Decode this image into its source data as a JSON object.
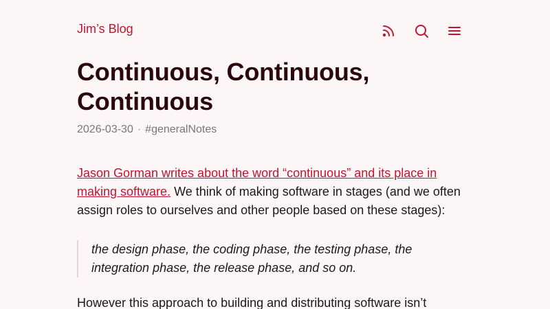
{
  "header": {
    "site_title": "Jim’s Blog",
    "icons": [
      "rss-icon",
      "search-icon",
      "menu-icon"
    ]
  },
  "post": {
    "title": "Continuous, Continuous, Continuous",
    "date": "2026-03-30",
    "meta_separator": "·",
    "tag": "#generalNotes",
    "intro_link": "Jason Gorman writes about the word “continuous” and its place in making software.",
    "intro_text": " We think of making software in stages (and we often assign roles to ourselves and other people based on these stages):",
    "quote": "the design phase, the coding phase, the testing phase, the integration phase, the release phase, and so on.",
    "after_quote": "However this approach to building and distributing software isn’t"
  },
  "colors": {
    "accent": "#c0152f",
    "title": "#2b0810",
    "background": "#fdf6f6",
    "meta": "#777777"
  }
}
